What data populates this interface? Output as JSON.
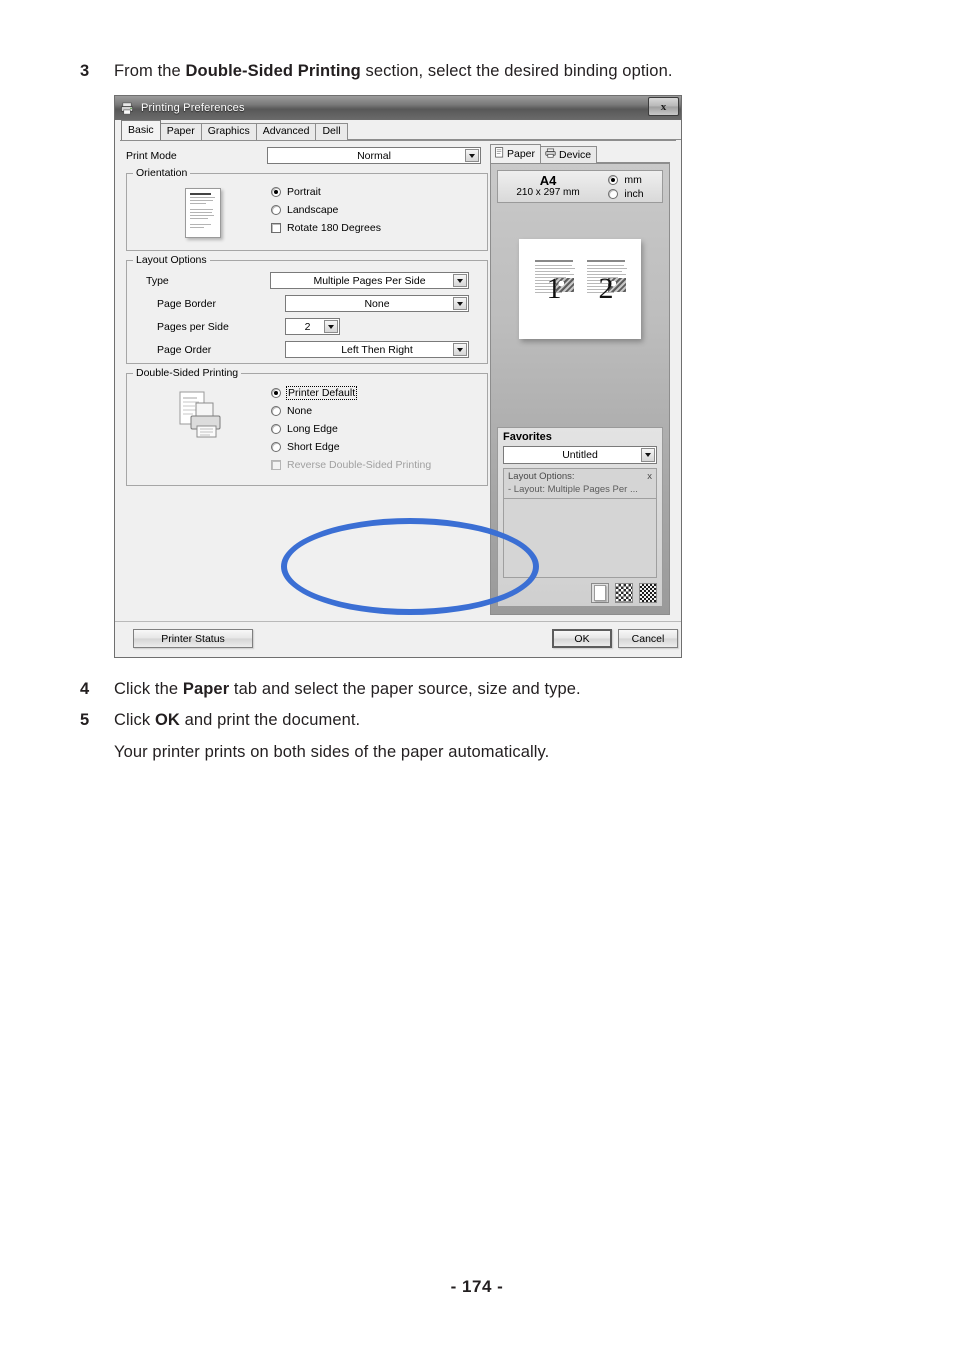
{
  "document": {
    "steps": [
      {
        "number": "3",
        "text_before": "From the ",
        "bold": "Double-Sided Printing",
        "text_after": " section, select the desired binding option."
      },
      {
        "number": "4",
        "text_before": "Click the ",
        "bold": "Paper",
        "text_after": " tab and select the paper source, size and type."
      },
      {
        "number": "5",
        "text_before": "Click ",
        "bold": "OK",
        "text_after": " and print the document."
      }
    ],
    "sub_note": "Your printer prints on both sides of the paper automatically.",
    "page_number": "- 174 -"
  },
  "dialog": {
    "title": "Printing Preferences",
    "title_icon": "printer-icon",
    "close_label": "x",
    "tabs": [
      {
        "label": "Basic",
        "active": true
      },
      {
        "label": "Paper",
        "active": false
      },
      {
        "label": "Graphics",
        "active": false
      },
      {
        "label": "Advanced",
        "active": false
      },
      {
        "label": "Dell",
        "active": false
      }
    ],
    "print_mode": {
      "label": "Print Mode",
      "value": "Normal"
    },
    "orientation": {
      "legend": "Orientation",
      "options": [
        {
          "label": "Portrait",
          "selected": true
        },
        {
          "label": "Landscape",
          "selected": false
        }
      ],
      "rotate": {
        "label": "Rotate 180 Degrees",
        "checked": false
      }
    },
    "layout_options": {
      "legend": "Layout Options",
      "fields": [
        {
          "label": "Type",
          "value": "Multiple Pages Per Side"
        },
        {
          "label": "Page Border",
          "value": "None"
        },
        {
          "label": "Pages per Side",
          "value": "2"
        },
        {
          "label": "Page Order",
          "value": "Left Then Right"
        }
      ]
    },
    "double_sided": {
      "legend": "Double-Sided Printing",
      "options": [
        {
          "label": "Printer Default",
          "selected": true,
          "focused": true
        },
        {
          "label": "None",
          "selected": false,
          "focused": false
        },
        {
          "label": "Long Edge",
          "selected": false,
          "focused": false
        },
        {
          "label": "Short Edge",
          "selected": false,
          "focused": false
        }
      ],
      "reverse": {
        "label": "Reverse Double-Sided Printing",
        "checked": false,
        "disabled": true
      },
      "highlight_color": "#3b6fd4"
    },
    "preview": {
      "tabs": [
        {
          "label": "Paper",
          "icon": "page-icon",
          "active": true
        },
        {
          "label": "Device",
          "icon": "printer-icon",
          "active": false
        }
      ],
      "paper_size": "A4",
      "paper_dimensions": "210 x 297 mm",
      "units": [
        {
          "label": "mm",
          "selected": true
        },
        {
          "label": "inch",
          "selected": false
        }
      ],
      "sheet_pages": [
        "1",
        "2"
      ]
    },
    "favorites": {
      "title": "Favorites",
      "selected": "Untitled",
      "list_header": "Layout Options:",
      "list_close": "x",
      "list_items": [
        "- Layout: Multiple Pages Per ..."
      ],
      "icons": [
        "blank-page-icon",
        "checker-page-icon",
        "checker-page-dark-icon"
      ]
    },
    "buttons": {
      "printer_status": "Printer Status",
      "ok": "OK",
      "cancel": "Cancel"
    }
  }
}
